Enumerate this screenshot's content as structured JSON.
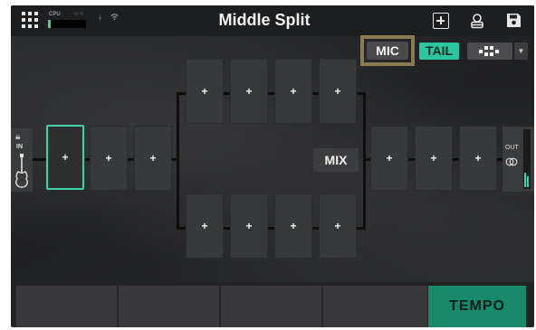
{
  "topbar": {
    "menu_icon": "grid-menu-icon",
    "cpu_label": "CPU",
    "cpu_percent_label": "% %",
    "cpu_load": 0.08,
    "bluetooth_icon": "bluetooth-icon",
    "wifi_icon": "wifi-icon",
    "preset_title": "Middle Split",
    "add_icon": "add-square-icon",
    "user_icon": "user-icon",
    "save_icon": "save-icon"
  },
  "controls": {
    "mic_label": "MIC",
    "tail_label": "TAIL",
    "layout_icon": "layout-grid-icon"
  },
  "chain": {
    "input_label": "IN",
    "output_label": "OUT",
    "mix_label": "MIX",
    "slot_symbol": "+",
    "lock_icon": "lock-icon",
    "guitar_icon": "guitar-icon",
    "stereo_icon": "stereo-rings-icon"
  },
  "footer": {
    "tempo_label": "TEMPO"
  },
  "colors": {
    "accent": "#2cc6a1",
    "tempo": "#168a6a",
    "highlight": "#8b7a50",
    "background": "#222325"
  }
}
